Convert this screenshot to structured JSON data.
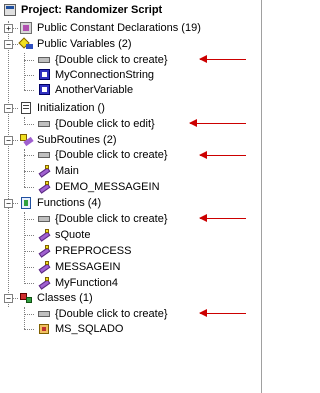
{
  "tree": {
    "project": {
      "label": "Project: Randomizer Script"
    },
    "constants": {
      "label": "Public Constant Declarations (19)"
    },
    "variables": {
      "label": "Public Variables (2)",
      "items": [
        "{Double click to create}",
        "MyConnectionString",
        "AnotherVariable"
      ]
    },
    "initialization": {
      "label": "Initialization ()",
      "items": [
        "{Double click to edit}"
      ]
    },
    "subroutines": {
      "label": "SubRoutines (2)",
      "items": [
        "{Double click to create}",
        "Main",
        "DEMO_MESSAGEIN"
      ]
    },
    "functions": {
      "label": "Functions (4)",
      "items": [
        "{Double click to create}",
        "sQuote",
        "PREPROCESS",
        "MESSAGEIN",
        "MyFunction4"
      ]
    },
    "classes": {
      "label": "Classes (1)",
      "items": [
        "{Double click to create}",
        "MS_SQLADO"
      ]
    }
  },
  "expand_glyphs": {
    "expanded": "−",
    "collapsed": "+"
  },
  "colors": {
    "annotation_arrow": "#cc0000",
    "tree_lines": "#808080"
  },
  "icons": {
    "project": "project-icon",
    "constants": "constants-folder-icon",
    "variables": "variables-folder-icon",
    "initialization": "initialization-icon",
    "subroutines": "subroutines-folder-icon",
    "functions": "functions-folder-icon",
    "classes": "classes-folder-icon",
    "placeholder": "create-placeholder-icon",
    "variable": "variable-icon",
    "procedure": "procedure-icon",
    "class": "class-icon"
  }
}
